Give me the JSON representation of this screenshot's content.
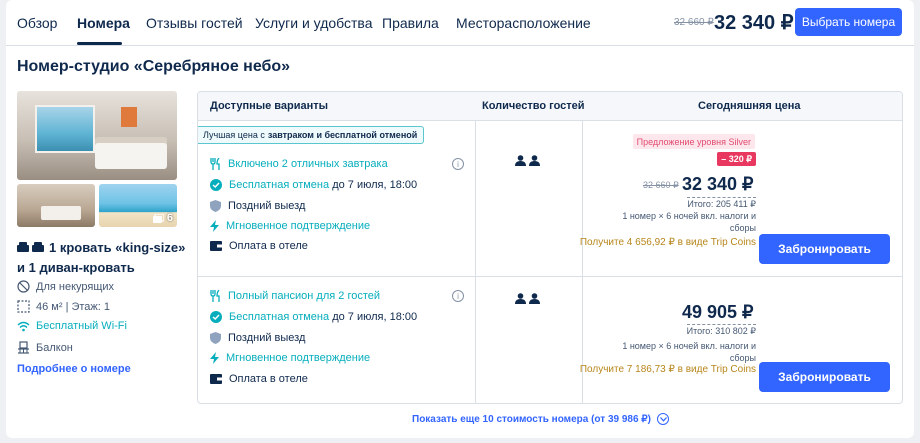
{
  "nav": {
    "tabs": [
      "Обзор",
      "Номера",
      "Отзывы гостей",
      "Услуги и удобства",
      "Правила",
      "Месторасположение"
    ],
    "old_price": "32 660 ₽",
    "price": "32 340 ₽",
    "select_button": "Выбрать номера"
  },
  "room": {
    "title": "Номер-студио «Серебряное небо»",
    "photo_count": "6",
    "bed_line1": "1 кровать «king-size»",
    "bed_line2": "и 1 диван-кровать",
    "amenities": [
      "Для некурящих",
      "46 м² | Этаж: 1",
      "Бесплатный Wi-Fi",
      "Балкон"
    ],
    "more_link": "Подробнее о номере"
  },
  "table": {
    "headers": [
      "Доступные варианты",
      "Количество гостей",
      "Сегодняшняя цена"
    ],
    "best_badge_prefix": "Лучшая цена с",
    "best_badge_bold": "завтраком и бесплатной отменой",
    "rows": [
      {
        "features": [
          {
            "text": "Включено 2 отличных завтрака",
            "extra": "",
            "icon": "fork-knife-icon"
          },
          {
            "text": "Бесплатная отмена",
            "extra": "до 7 июля, 18:00",
            "icon": "check-circle-icon"
          },
          {
            "text": "Поздний выезд",
            "extra": "",
            "icon": "shield-icon"
          },
          {
            "text": "Мгновенное подтверждение",
            "extra": "",
            "icon": "lightning-icon"
          },
          {
            "text": "Оплата в отеле",
            "extra": "",
            "icon": "wallet-icon"
          }
        ],
        "silver_label": "Предложение уровня Silver",
        "discount": "– 320 ₽",
        "old_price": "32 660 ₽",
        "price": "32 340 ₽",
        "total": "Итого: 205 411 ₽",
        "note": "1 номер × 6 ночей вкл. налоги и сборы",
        "coins": "Получите 4 656,92 ₽ в виде Trip Coins",
        "book": "Забронировать"
      },
      {
        "features": [
          {
            "text": "Полный пансион для 2 гостей",
            "extra": "",
            "icon": "fork-knife-icon"
          },
          {
            "text": "Бесплатная отмена",
            "extra": "до 7 июля, 18:00",
            "icon": "check-circle-icon"
          },
          {
            "text": "Поздний выезд",
            "extra": "",
            "icon": "shield-icon"
          },
          {
            "text": "Мгновенное подтверждение",
            "extra": "",
            "icon": "lightning-icon"
          },
          {
            "text": "Оплата в отеле",
            "extra": "",
            "icon": "wallet-icon"
          }
        ],
        "price": "49 905 ₽",
        "total": "Итого: 310 802 ₽",
        "note": "1 номер × 6 ночей вкл. налоги и сборы",
        "coins": "Получите 7 186,73 ₽ в виде Trip Coins",
        "book": "Забронировать"
      }
    ],
    "show_more": "Показать еще 10 стоимость номера (от 39 986 ₽)"
  },
  "colors": {
    "primary": "#3264ff",
    "teal": "#06aebd",
    "navy": "#0f294d",
    "gold": "#b7861b",
    "discount": "#e8385f"
  }
}
